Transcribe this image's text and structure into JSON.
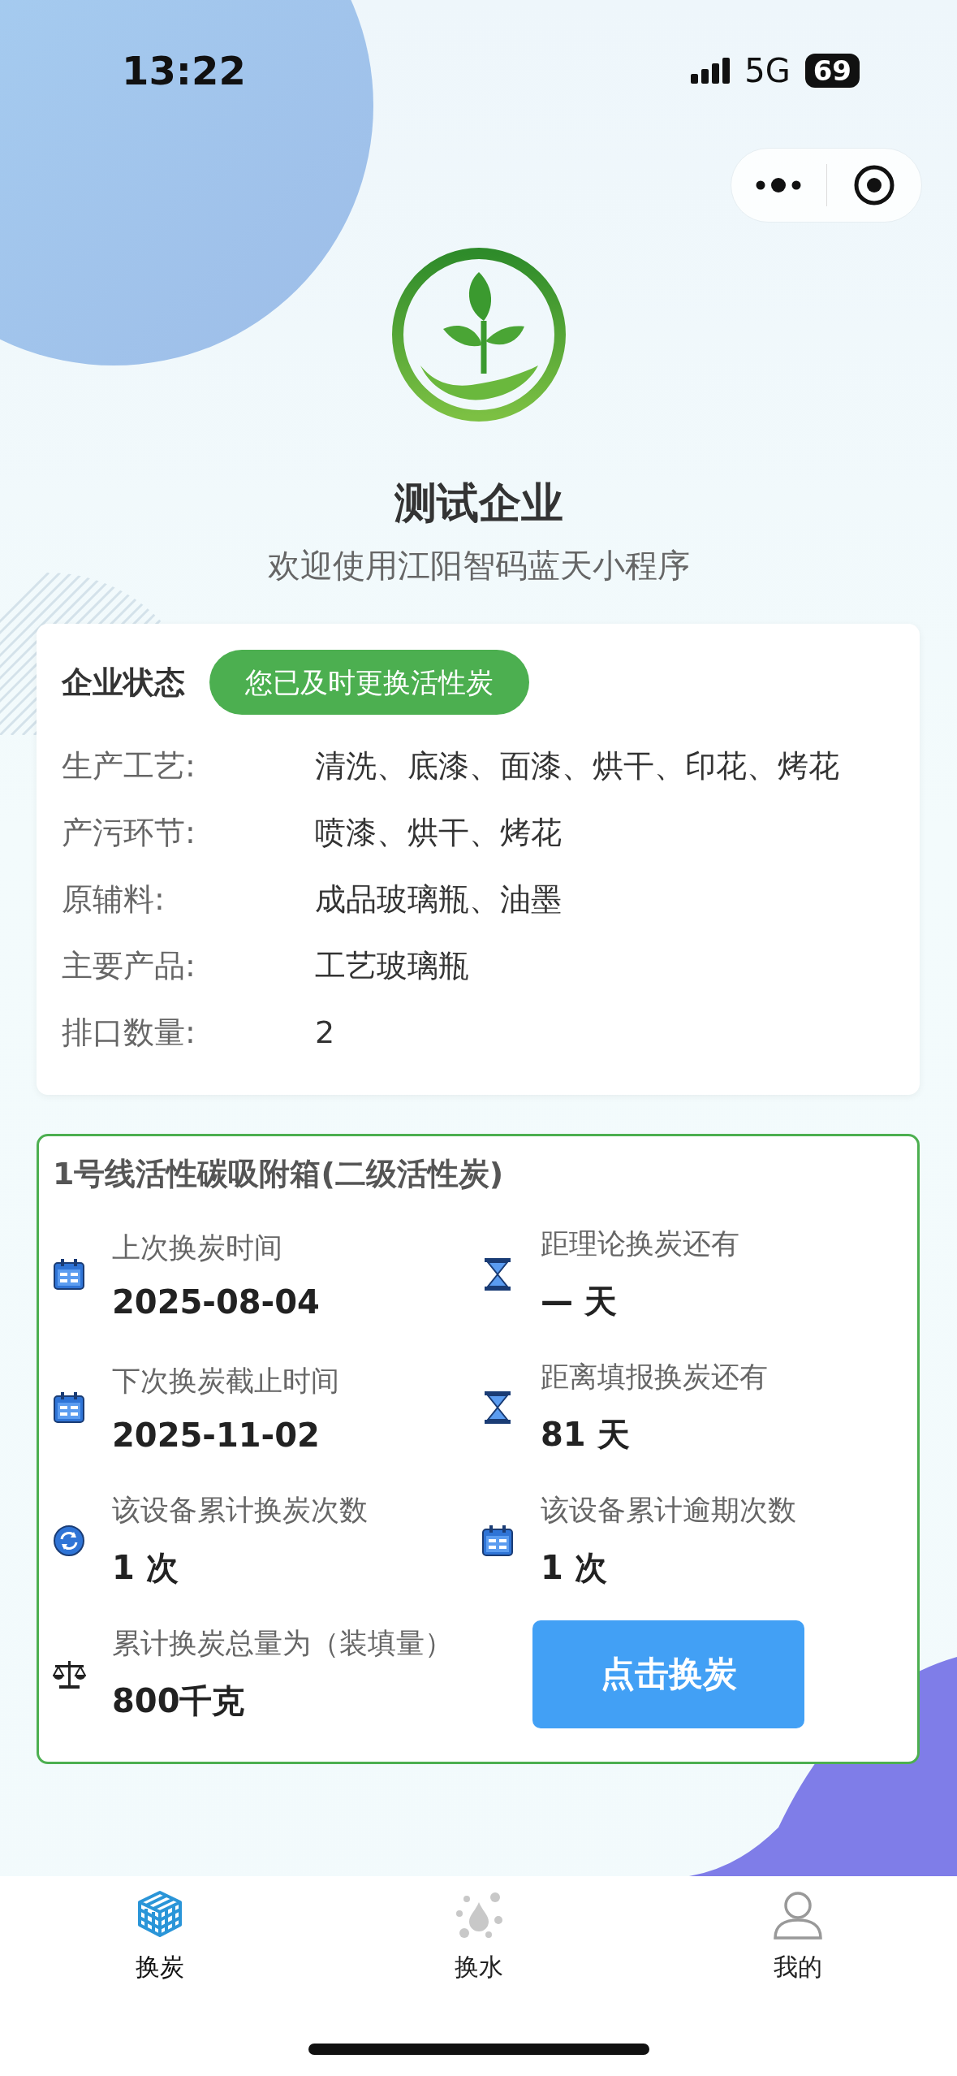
{
  "status_bar": {
    "time": "13:22",
    "network": "5G",
    "battery": "69"
  },
  "company": {
    "name": "测试企业",
    "welcome": "欢迎使用江阳智码蓝天小程序"
  },
  "company_card": {
    "status_label": "企业状态",
    "status_badge": "您已及时更换活性炭",
    "rows": [
      {
        "label": "生产工艺:",
        "value": "清洗、底漆、面漆、烘干、印花、烤花"
      },
      {
        "label": "产污环节:",
        "value": "喷漆、烘干、烤花"
      },
      {
        "label": "原辅料:",
        "value": "成品玻璃瓶、油墨"
      },
      {
        "label": "主要产品:",
        "value": "工艺玻璃瓶"
      },
      {
        "label": "排口数量:",
        "value": "2"
      }
    ]
  },
  "device_card": {
    "title": "1号线活性碳吸附箱(二级活性炭)",
    "stats": [
      {
        "label": "上次换炭时间",
        "value": "2025-08-04"
      },
      {
        "label": "距理论换炭还有",
        "value": "— 天"
      },
      {
        "label": "下次换炭截止时间",
        "value": "2025-11-02"
      },
      {
        "label": "距离填报换炭还有",
        "value": "81 天"
      },
      {
        "label": "该设备累计换炭次数",
        "value": "1 次"
      },
      {
        "label": "该设备累计逾期次数",
        "value": "1 次"
      },
      {
        "label": "累计换炭总量为（装填量）",
        "value": "800千克"
      }
    ],
    "button": "点击换炭"
  },
  "tabs": [
    {
      "label": "换炭",
      "selected": true
    },
    {
      "label": "换水",
      "selected": false
    },
    {
      "label": "我的",
      "selected": false
    }
  ]
}
